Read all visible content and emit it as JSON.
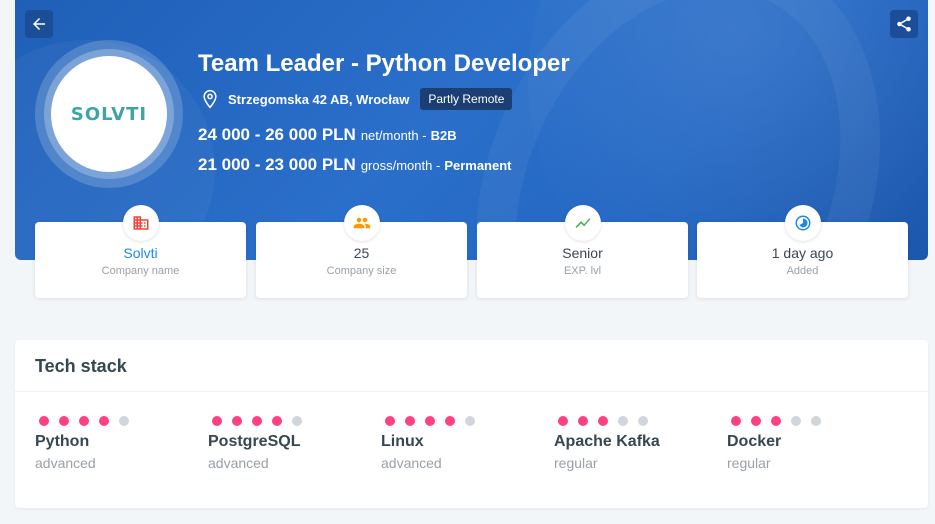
{
  "offer": {
    "title": "Team Leader - Python Developer",
    "address": "Strzegomska 42 AB, Wrocław",
    "remote_badge": "Partly Remote",
    "logo_text": "SOLVTI",
    "salaries": [
      {
        "amount": "24 000 - 26 000 PLN",
        "period": "net/month -",
        "type": "B2B"
      },
      {
        "amount": "21 000 - 23 000 PLN",
        "period": "gross/month -",
        "type": "Permanent"
      }
    ]
  },
  "info_cards": [
    {
      "value": "Solvti",
      "label": "Company name",
      "icon": "building-icon",
      "color": "#f44336"
    },
    {
      "value": "25",
      "label": "Company size",
      "icon": "people-icon",
      "color": "#ff9800"
    },
    {
      "value": "Senior",
      "label": "EXP. lvl",
      "icon": "chart-up-icon",
      "color": "#4caf50"
    },
    {
      "value": "1 day ago",
      "label": "Added",
      "icon": "clock-icon",
      "color": "#1e88e5"
    }
  ],
  "tech_stack": {
    "title": "Tech stack",
    "skills": [
      {
        "name": "Python",
        "level": "advanced",
        "dots_filled": 4,
        "dots_total": 5
      },
      {
        "name": "PostgreSQL",
        "level": "advanced",
        "dots_filled": 4,
        "dots_total": 5
      },
      {
        "name": "Linux",
        "level": "advanced",
        "dots_filled": 4,
        "dots_total": 5
      },
      {
        "name": "Apache Kafka",
        "level": "regular",
        "dots_filled": 3,
        "dots_total": 5
      },
      {
        "name": "Docker",
        "level": "regular",
        "dots_filled": 3,
        "dots_total": 5
      }
    ]
  },
  "colors": {
    "hero": "#2468c4",
    "accent_dot": "#ff4081",
    "link": "#1e88e5"
  }
}
